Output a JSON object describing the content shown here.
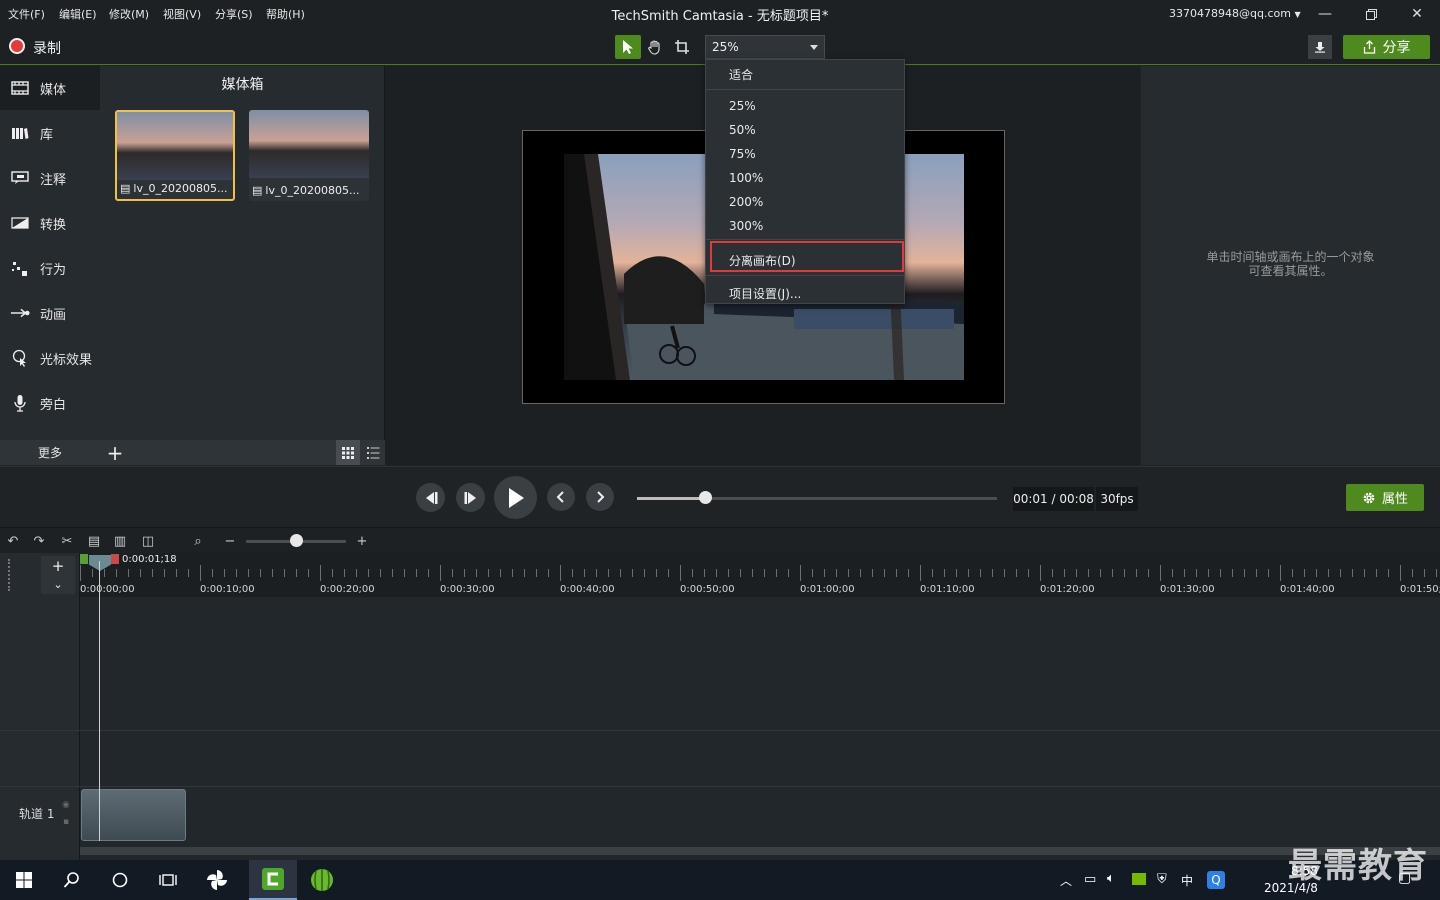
{
  "menubar": {
    "items": [
      "文件(F)",
      "编辑(E)",
      "修改(M)",
      "视图(V)",
      "分享(S)",
      "帮助(H)"
    ],
    "title": "TechSmith Camtasia - 无标题项目*",
    "account": "3370478948@qq.com"
  },
  "toolbar": {
    "record_label": "录制",
    "zoom_value": "25%",
    "share_label": "分享"
  },
  "zoom_menu": {
    "items": [
      "适合",
      "25%",
      "50%",
      "75%",
      "100%",
      "200%",
      "300%",
      "分离画布(D)",
      "项目设置(J)..."
    ]
  },
  "leftnav": {
    "items": [
      {
        "label": "媒体",
        "icon": "media-icon"
      },
      {
        "label": "库",
        "icon": "library-icon"
      },
      {
        "label": "注释",
        "icon": "annotation-icon"
      },
      {
        "label": "转换",
        "icon": "transition-icon"
      },
      {
        "label": "行为",
        "icon": "behavior-icon"
      },
      {
        "label": "动画",
        "icon": "animation-icon"
      },
      {
        "label": "光标效果",
        "icon": "cursor-effect-icon"
      },
      {
        "label": "旁白",
        "icon": "microphone-icon"
      }
    ],
    "more_label": "更多"
  },
  "mediabin": {
    "title": "媒体箱",
    "clips": [
      {
        "label": "lv_0_20200805..."
      },
      {
        "label": "lv_0_20200805..."
      }
    ]
  },
  "properties": {
    "hint_line1": "单击时间轴或画布上的一个对象",
    "hint_line2": "可查看其属性。",
    "button_label": "属性"
  },
  "playback": {
    "timecode": "00:01 / 00:08",
    "fps": "30fps",
    "progress": 0.19
  },
  "timeline": {
    "playhead_time": "0:00:01;18",
    "ticks": [
      "0:00:00;00",
      "0:00:10;00",
      "0:00:20;00",
      "0:00:30;00",
      "0:00:40;00",
      "0:00:50;00",
      "0:01:00;00",
      "0:01:10;00",
      "0:01:20;00",
      "0:01:30;00",
      "0:01:40;00",
      "0:01:50;"
    ],
    "track_label": "轨道 1",
    "zoom_level": 0.5
  },
  "taskbar": {
    "time": "8:58",
    "date": "2021/4/8"
  },
  "watermark": "最需教育",
  "colors": {
    "accent_green": "#4f8a1f",
    "record_red": "#e23b3b",
    "highlight_red": "#e03a3a",
    "selected_thumb": "#f0c04a"
  }
}
